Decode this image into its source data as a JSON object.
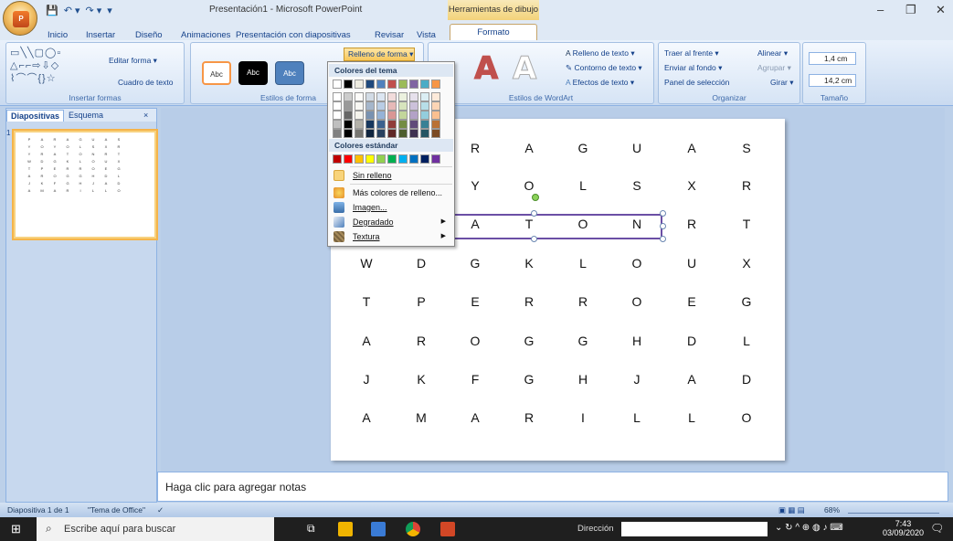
{
  "window": {
    "title": "Presentación1 - Microsoft PowerPoint",
    "context_tab_header": "Herramientas de dibujo",
    "minimize": "–",
    "maximize": "❐",
    "close": "✕"
  },
  "tabs": [
    "Inicio",
    "Insertar",
    "Diseño",
    "Animaciones",
    "Presentación con diapositivas",
    "Revisar",
    "Vista",
    "Formato"
  ],
  "ribbon": {
    "insert_shapes": {
      "label": "Insertar formas",
      "edit_shape": "Editar forma ▾",
      "text_box": "Cuadro de texto"
    },
    "shape_styles": {
      "label": "Estilos de forma",
      "fill_button": "Relleno de forma ▾",
      "sample": "Abc"
    },
    "wordart": {
      "label": "Estilos de WordArt",
      "text_fill": "Relleno de texto ▾",
      "text_outline": "Contorno de texto ▾",
      "text_effects": "Efectos de texto ▾",
      "letter": "A"
    },
    "arrange": {
      "label": "Organizar",
      "bring_front": "Traer al frente ▾",
      "send_back": "Enviar al fondo ▾",
      "selection_pane": "Panel de selección",
      "align": "Alinear ▾",
      "group": "Agrupar ▾",
      "rotate": "Girar ▾"
    },
    "size": {
      "label": "Tamaño",
      "height": "1,4 cm",
      "width": "14,2 cm"
    }
  },
  "dropdown": {
    "theme_colors_header": "Colores del tema",
    "standard_colors_header": "Colores estándar",
    "no_fill": "Sin relleno",
    "more_colors": "Más colores de relleno...",
    "picture": "Imagen...",
    "gradient": "Degradado",
    "texture": "Textura",
    "theme_colors": [
      "#ffffff",
      "#000000",
      "#eeece1",
      "#1f497d",
      "#4f81bd",
      "#c0504d",
      "#9bbb59",
      "#8064a2",
      "#4bacc6",
      "#f79646"
    ],
    "standard_colors": [
      "#c00000",
      "#ff0000",
      "#ffc000",
      "#ffff00",
      "#92d050",
      "#00b050",
      "#00b0f0",
      "#0070c0",
      "#002060",
      "#7030a0"
    ]
  },
  "left_panel": {
    "tab_slides": "Diapositivas",
    "tab_outline": "Esquema",
    "close": "×",
    "slide_number": "1"
  },
  "puzzle": {
    "rows": [
      [
        "P",
        "A",
        "R",
        "A",
        "G",
        "U",
        "A",
        "S"
      ],
      [
        "Y",
        "O",
        "Y",
        "O",
        "L",
        "S",
        "X",
        "R"
      ],
      [
        "Y",
        "R",
        "A",
        "T",
        "O",
        "N",
        "R",
        "T"
      ],
      [
        "W",
        "D",
        "G",
        "K",
        "L",
        "O",
        "U",
        "X"
      ],
      [
        "T",
        "P",
        "E",
        "R",
        "R",
        "O",
        "E",
        "G"
      ],
      [
        "A",
        "R",
        "O",
        "G",
        "G",
        "H",
        "D",
        "L"
      ],
      [
        "J",
        "K",
        "F",
        "G",
        "H",
        "J",
        "A",
        "D"
      ],
      [
        "A",
        "M",
        "A",
        "R",
        "I",
        "L",
        "L",
        "O"
      ]
    ],
    "highlighted_word": "RATON"
  },
  "notes_placeholder": "Haga clic para agregar notas",
  "status": {
    "slide_info": "Diapositiva 1 de 1",
    "theme": "\"Tema de Office\"",
    "zoom": "68%"
  },
  "taskbar": {
    "search_placeholder": "Escribe aquí para buscar",
    "address_label": "Dirección",
    "time": "7:43",
    "date": "03/09/2020"
  }
}
